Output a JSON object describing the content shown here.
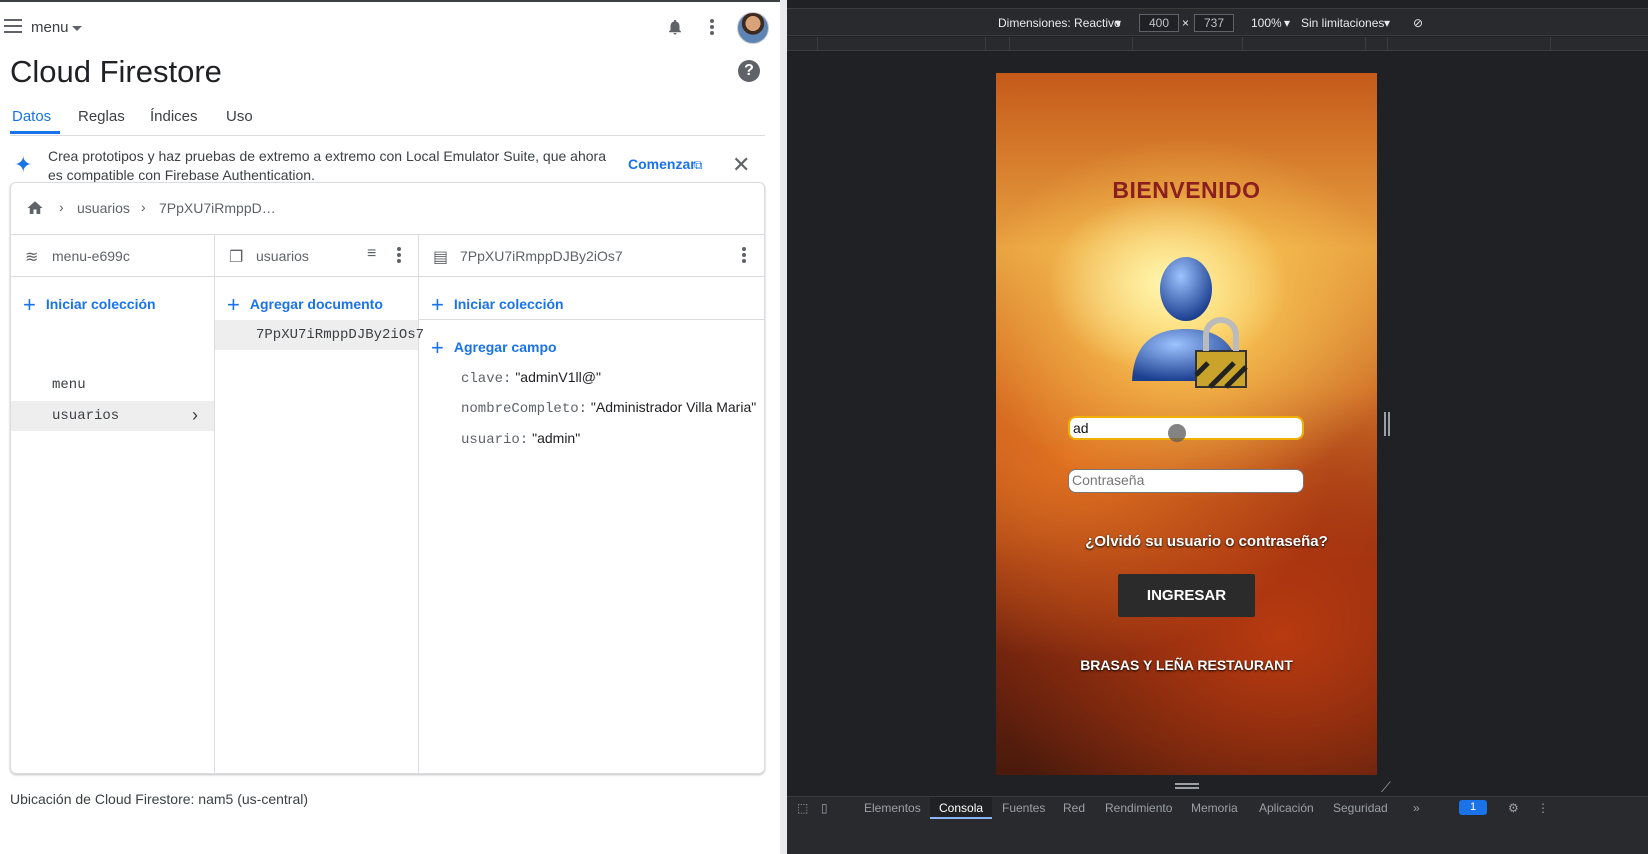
{
  "firebase": {
    "topbar": {
      "menu_label": "menu"
    },
    "title": "Cloud Firestore",
    "tabs": [
      "Datos",
      "Reglas",
      "Índices",
      "Uso"
    ],
    "banner": {
      "text": "Crea prototipos y haz pruebas de extremo a extremo con Local Emulator Suite, que ahora es compatible con Firebase Authentication.",
      "action": "Comenzar"
    },
    "breadcrumb": [
      "usuarios",
      "7PpXU7iRmppD…"
    ],
    "columns": {
      "project": {
        "title": "menu-e699c",
        "add_label": "Iniciar colección",
        "items": [
          "menu",
          "usuarios"
        ]
      },
      "collection": {
        "title": "usuarios",
        "add_label": "Agregar documento",
        "items": [
          "7PpXU7iRmppDJBy2iOs7"
        ]
      },
      "document": {
        "title": "7PpXU7iRmppDJBy2iOs7",
        "add_collection": "Iniciar colección",
        "add_field": "Agregar campo",
        "fields": [
          {
            "key": "clave:",
            "value": "\"adminV1ll@\""
          },
          {
            "key": "nombreCompleto:",
            "value": "\"Administrador Villa Maria\""
          },
          {
            "key": "usuario:",
            "value": "\"admin\""
          }
        ]
      }
    },
    "location": "Ubicación de Cloud Firestore: nam5 (us-central)"
  },
  "devtools": {
    "dimensions_label": "Dimensiones: Reactivo",
    "width": "400",
    "height": "737",
    "zoom": "100%",
    "throttle": "Sin limitaciones",
    "app": {
      "welcome": "BIENVENIDO",
      "user_value": "ad",
      "password_placeholder": "Contraseña",
      "forgot": "¿Olvidó su usuario o contraseña?",
      "login_button": "INGRESAR",
      "restaurant": "BRASAS Y LEÑA RESTAURANT"
    },
    "drawer_tabs": [
      "Elementos",
      "Consola",
      "Fuentes",
      "Red",
      "Rendimiento",
      "Memoria",
      "Aplicación",
      "Seguridad"
    ],
    "issues_count": "1"
  }
}
